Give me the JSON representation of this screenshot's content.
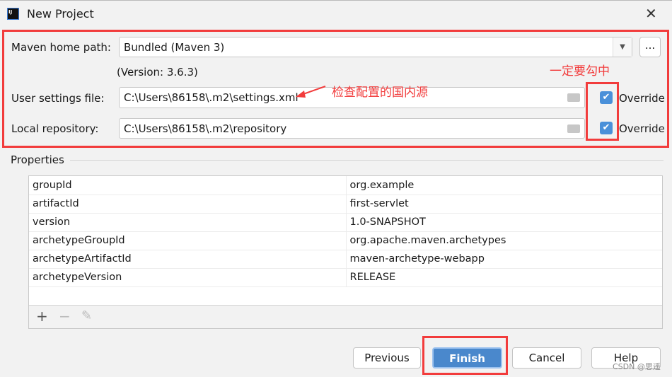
{
  "window": {
    "title": "New Project",
    "icon": "intellij-icon",
    "close": "✕"
  },
  "maven": {
    "home_label": "Maven home path:",
    "home_value": "Bundled (Maven 3)",
    "version": "(Version: 3.6.3)",
    "browse": "...",
    "settings_label": "User settings file:",
    "settings_value": "C:\\Users\\86158\\.m2\\settings.xml",
    "settings_override": "Override",
    "settings_override_checked": true,
    "repo_label": "Local repository:",
    "repo_value": "C:\\Users\\86158\\.m2\\repository",
    "repo_override": "Override",
    "repo_override_checked": true
  },
  "annotations": {
    "check_source": "检查配置的国内源",
    "must_check": "一定要勾中",
    "annotation_color": "#f23c3c"
  },
  "properties": {
    "label": "Properties",
    "rows": [
      {
        "key": "groupId",
        "value": "org.example"
      },
      {
        "key": "artifactId",
        "value": "first-servlet"
      },
      {
        "key": "version",
        "value": "1.0-SNAPSHOT"
      },
      {
        "key": "archetypeGroupId",
        "value": "org.apache.maven.archetypes"
      },
      {
        "key": "archetypeArtifactId",
        "value": "maven-archetype-webapp"
      },
      {
        "key": "archetypeVersion",
        "value": "RELEASE"
      }
    ],
    "add": "+",
    "remove": "−",
    "edit": "✎"
  },
  "buttons": {
    "previous": "Previous",
    "finish": "Finish",
    "cancel": "Cancel",
    "help": "Help"
  },
  "watermark": "CSDN @思遥"
}
